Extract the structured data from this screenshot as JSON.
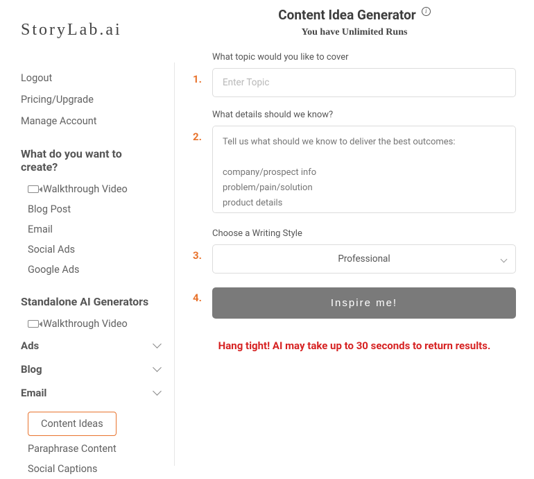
{
  "brand": "StoryLab.ai",
  "sidebar": {
    "top_links": [
      {
        "label": "Logout"
      },
      {
        "label": "Pricing/Upgrade"
      },
      {
        "label": "Manage Account"
      }
    ],
    "create_heading": "What do you want to create?",
    "create_items": [
      {
        "label": "Walkthrough Video",
        "icon": "video"
      },
      {
        "label": "Blog Post"
      },
      {
        "label": "Email"
      },
      {
        "label": "Social Ads"
      },
      {
        "label": "Google Ads"
      }
    ],
    "standalone_heading": "Standalone AI Generators",
    "standalone_items": [
      {
        "label": "Walkthrough Video",
        "icon": "video"
      }
    ],
    "groups": [
      {
        "label": "Ads"
      },
      {
        "label": "Blog"
      },
      {
        "label": "Email"
      }
    ],
    "bottom_items": [
      {
        "label": "Content Ideas",
        "active": true
      },
      {
        "label": "Paraphrase Content"
      },
      {
        "label": "Social Captions"
      }
    ]
  },
  "main": {
    "title": "Content Idea Generator",
    "subtitle": "You have Unlimited Runs",
    "steps": {
      "n1": "1.",
      "n2": "2.",
      "n3": "3.",
      "n4": "4."
    },
    "topic": {
      "label": "What topic would you like to cover",
      "placeholder": "Enter Topic",
      "value": ""
    },
    "details": {
      "label": "What details should we know?",
      "placeholder": "Tell us what should we know to deliver the best outcomes:\n\ncompany/prospect info\nproblem/pain/solution\nproduct details\nyour secret sauce (Just kidding)",
      "value": ""
    },
    "style": {
      "label": "Choose a Writing Style",
      "selected": "Professional"
    },
    "submit_label": "Inspire me!",
    "wait_message": "Hang tight! AI may take up to 30 seconds to return results."
  }
}
